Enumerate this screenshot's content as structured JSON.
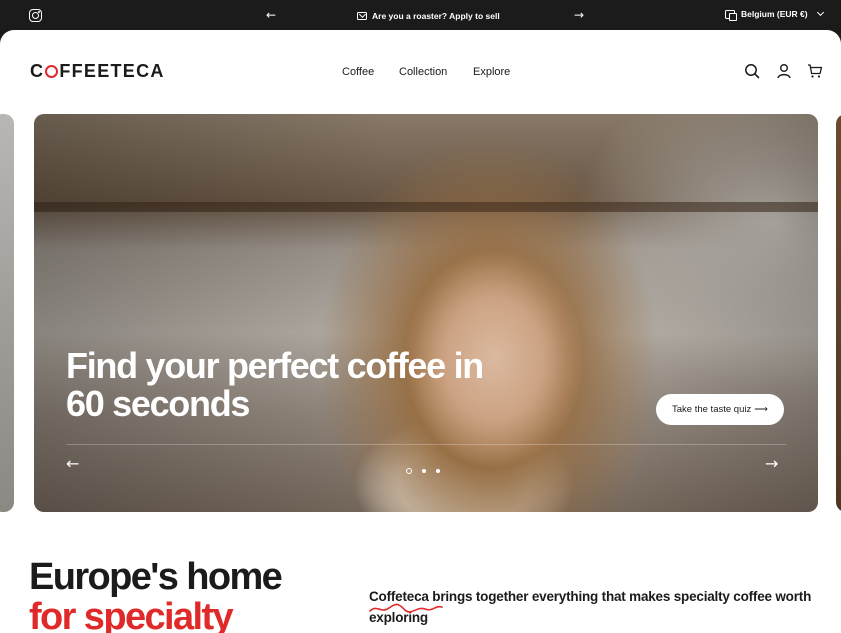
{
  "announcement_bar": {
    "instagram_icon": "instagram-icon",
    "prev_arrow": "←",
    "next_arrow": "→",
    "message": "Are you a roaster? Apply to sell",
    "locale": "Belgium (EUR €)"
  },
  "header": {
    "logo_start": "C",
    "logo_end": "FFEETECA",
    "nav": [
      "Coffee",
      "Collection",
      "Explore"
    ],
    "icons": [
      "search-icon",
      "account-icon",
      "cart-icon"
    ]
  },
  "hero": {
    "headline": "Find your perfect coffee in 60 seconds",
    "cta_label": "Take the taste quiz",
    "cta_arrow": "⟶",
    "prev_arrow": "←",
    "next_arrow": "→",
    "slides": 3,
    "active_slide": 1
  },
  "intro": {
    "title_line1": "Europe's home",
    "title_line2": "for specialty",
    "brand": "Coffeteca",
    "text_rest": " brings together everything that makes specialty coffee worth exploring"
  },
  "colors": {
    "accent": "#e02a2a",
    "dark": "#1b1b1b",
    "background": "#ffffff"
  }
}
